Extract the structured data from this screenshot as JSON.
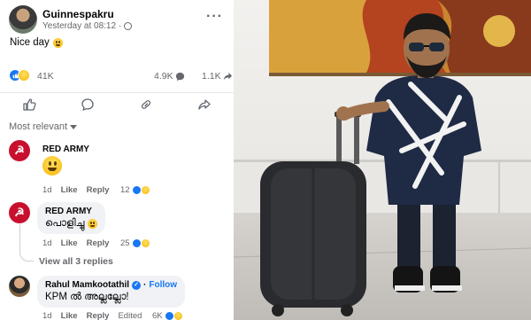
{
  "post": {
    "author": "Guinnespakru",
    "timestamp": "Yesterday at 08:12",
    "text": "Nice day",
    "reactions_count": "41K",
    "comments_count": "4.9K",
    "shares_count": "1.1K"
  },
  "actions": {
    "like_icon": "thumbs-up-icon",
    "comment_icon": "comment-bubble-icon",
    "share_link_icon": "link-icon",
    "share_icon": "share-arrow-icon"
  },
  "sort": {
    "label": "Most relevant"
  },
  "comments": [
    {
      "name": "RED ARMY",
      "text": "",
      "time": "1d",
      "like_label": "Like",
      "reply_label": "Reply",
      "reactions": "12"
    },
    {
      "name": "RED ARMY",
      "text": "പൊളിച്ചു",
      "time": "1d",
      "like_label": "Like",
      "reply_label": "Reply",
      "reactions": "25"
    },
    {
      "name": "Rahul Mamkootathil",
      "follow_label": "Follow",
      "text": "KPM ൽ അല്ലല്ലോ!",
      "time": "1d",
      "like_label": "Like",
      "reply_label": "Reply",
      "edited_label": "Edited",
      "reactions": "6K"
    }
  ],
  "view_replies": "View all 3 replies",
  "colors": {
    "facebook_blue": "#1877f2",
    "red_army": "#c8102e",
    "muted_text": "#65676b"
  }
}
